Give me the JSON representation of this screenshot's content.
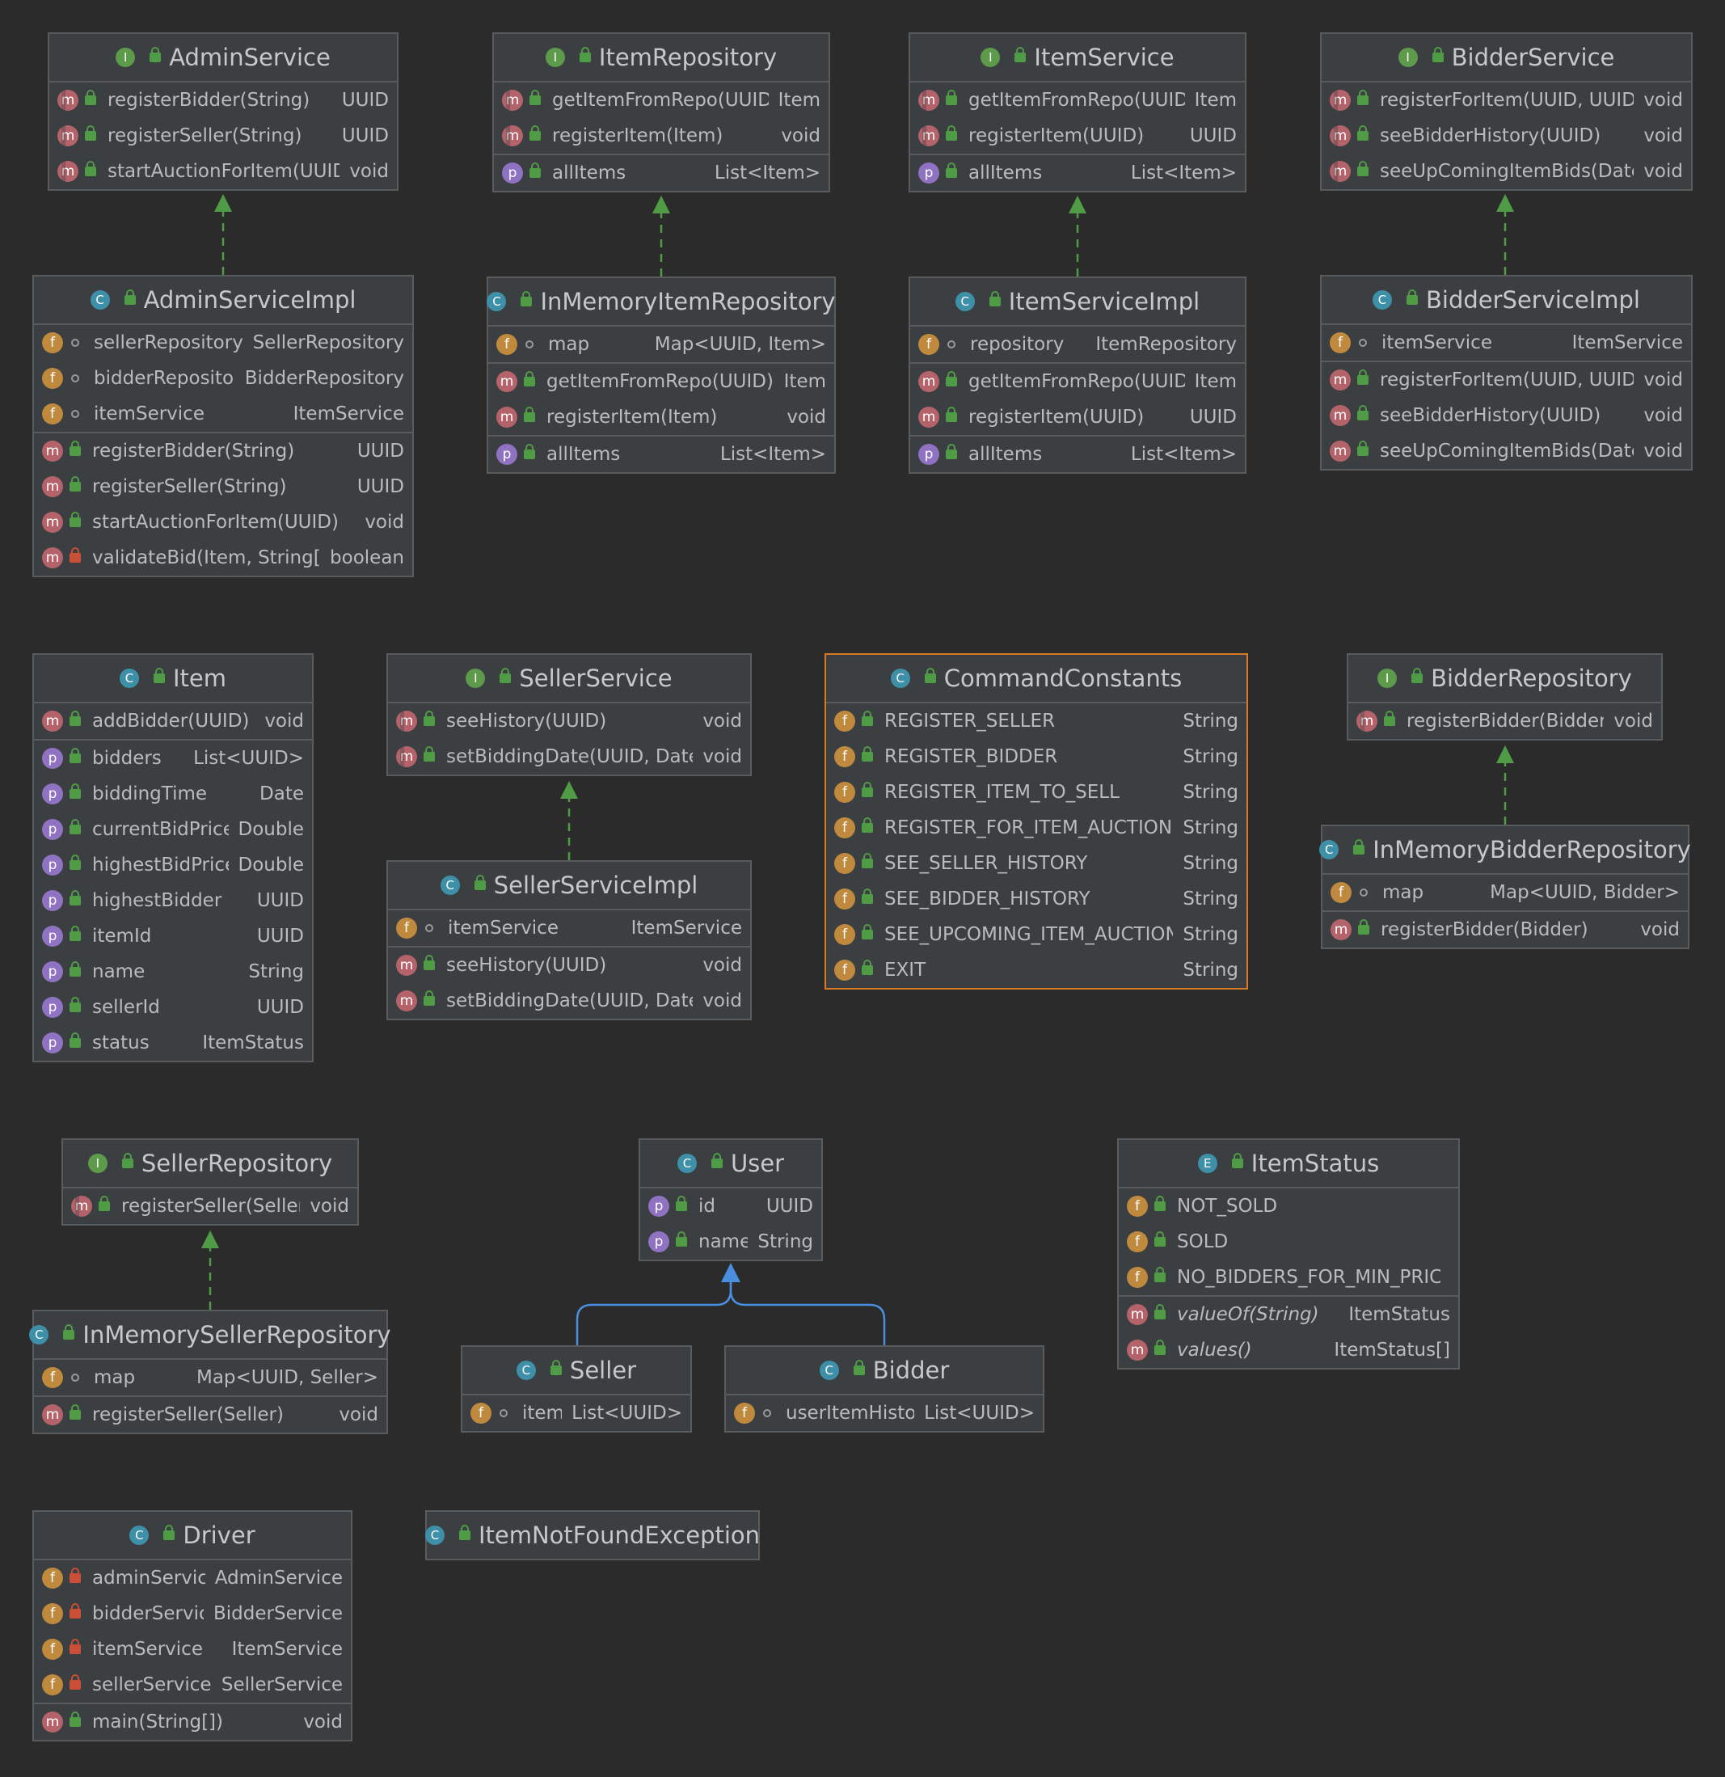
{
  "colors": {
    "background": "#2b2b2b",
    "class_fill": "#3c3f41",
    "border": "#595b5d",
    "selected_border": "#d97a25",
    "realization_edge": "#4f9b46",
    "inheritance_edge": "#4a8ee0"
  },
  "classes": {
    "admin_service": {
      "kind": "I",
      "title": "AdminService",
      "members": [
        [
          {
            "icon": "m",
            "abs": true,
            "vis": "pub",
            "name": "registerBidder(String)",
            "type": "UUID"
          },
          {
            "icon": "m",
            "abs": true,
            "vis": "pub",
            "name": "registerSeller(String)",
            "type": "UUID"
          },
          {
            "icon": "m",
            "abs": true,
            "vis": "pub",
            "name": "startAuctionForItem(UUID)",
            "type": "void"
          }
        ]
      ]
    },
    "item_repository": {
      "kind": "I",
      "title": "ItemRepository",
      "members": [
        [
          {
            "icon": "m",
            "abs": true,
            "vis": "pub",
            "name": "getItemFromRepo(UUID)",
            "type": "Item"
          },
          {
            "icon": "m",
            "abs": true,
            "vis": "pub",
            "name": "registerItem(Item)",
            "type": "void"
          }
        ],
        [
          {
            "icon": "p",
            "vis": "pub",
            "name": "allItems",
            "type": "List<Item>"
          }
        ]
      ]
    },
    "item_service": {
      "kind": "I",
      "title": "ItemService",
      "members": [
        [
          {
            "icon": "m",
            "abs": true,
            "vis": "pub",
            "name": "getItemFromRepo(UUID)",
            "type": "Item"
          },
          {
            "icon": "m",
            "abs": true,
            "vis": "pub",
            "name": "registerItem(UUID)",
            "type": "UUID"
          }
        ],
        [
          {
            "icon": "p",
            "vis": "pub",
            "name": "allItems",
            "type": "List<Item>"
          }
        ]
      ]
    },
    "bidder_service": {
      "kind": "I",
      "title": "BidderService",
      "members": [
        [
          {
            "icon": "m",
            "abs": true,
            "vis": "pub",
            "name": "registerForItem(UUID, UUID)",
            "type": "void"
          },
          {
            "icon": "m",
            "abs": true,
            "vis": "pub",
            "name": "seeBidderHistory(UUID)",
            "type": "void"
          },
          {
            "icon": "m",
            "abs": true,
            "vis": "pub",
            "name": "seeUpComingItemBids(Date)",
            "type": "void"
          }
        ]
      ]
    },
    "admin_service_impl": {
      "kind": "C",
      "title": "AdminServiceImpl",
      "members": [
        [
          {
            "icon": "f",
            "vis": "pkg",
            "name": "sellerRepository",
            "type": "SellerRepository"
          },
          {
            "icon": "f",
            "vis": "pkg",
            "name": "bidderRepository",
            "type": "BidderRepository"
          },
          {
            "icon": "f",
            "vis": "pkg",
            "name": "itemService",
            "type": "ItemService"
          }
        ],
        [
          {
            "icon": "m",
            "vis": "pub",
            "name": "registerBidder(String)",
            "type": "UUID"
          },
          {
            "icon": "m",
            "vis": "pub",
            "name": "registerSeller(String)",
            "type": "UUID"
          },
          {
            "icon": "m",
            "vis": "pub",
            "name": "startAuctionForItem(UUID)",
            "type": "void"
          },
          {
            "icon": "m",
            "vis": "priv",
            "name": "validateBid(Item, String[])",
            "type": "boolean"
          }
        ]
      ]
    },
    "in_memory_item_repository": {
      "kind": "C",
      "title": "InMemoryItemRepository",
      "members": [
        [
          {
            "icon": "f",
            "vis": "pkg",
            "name": "map",
            "type": "Map<UUID, Item>"
          }
        ],
        [
          {
            "icon": "m",
            "vis": "pub",
            "name": "getItemFromRepo(UUID)",
            "type": "Item"
          },
          {
            "icon": "m",
            "vis": "pub",
            "name": "registerItem(Item)",
            "type": "void"
          }
        ],
        [
          {
            "icon": "p",
            "vis": "pub",
            "name": "allItems",
            "type": "List<Item>"
          }
        ]
      ]
    },
    "item_service_impl": {
      "kind": "C",
      "title": "ItemServiceImpl",
      "members": [
        [
          {
            "icon": "f",
            "vis": "pkg",
            "name": "repository",
            "type": "ItemRepository"
          }
        ],
        [
          {
            "icon": "m",
            "vis": "pub",
            "name": "getItemFromRepo(UUID)",
            "type": "Item"
          },
          {
            "icon": "m",
            "vis": "pub",
            "name": "registerItem(UUID)",
            "type": "UUID"
          }
        ],
        [
          {
            "icon": "p",
            "vis": "pub",
            "name": "allItems",
            "type": "List<Item>"
          }
        ]
      ]
    },
    "bidder_service_impl": {
      "kind": "C",
      "title": "BidderServiceImpl",
      "members": [
        [
          {
            "icon": "f",
            "vis": "pkg",
            "name": "itemService",
            "type": "ItemService"
          }
        ],
        [
          {
            "icon": "m",
            "vis": "pub",
            "name": "registerForItem(UUID, UUID)",
            "type": "void"
          },
          {
            "icon": "m",
            "vis": "pub",
            "name": "seeBidderHistory(UUID)",
            "type": "void"
          },
          {
            "icon": "m",
            "vis": "pub",
            "name": "seeUpComingItemBids(Date)",
            "type": "void"
          }
        ]
      ]
    },
    "item": {
      "kind": "C",
      "title": "Item",
      "members": [
        [
          {
            "icon": "m",
            "vis": "pub",
            "name": "addBidder(UUID)",
            "type": "void"
          }
        ],
        [
          {
            "icon": "p",
            "vis": "pub",
            "name": "bidders",
            "type": "List<UUID>"
          },
          {
            "icon": "p",
            "vis": "pub",
            "name": "biddingTime",
            "type": "Date"
          },
          {
            "icon": "p",
            "vis": "pub",
            "name": "currentBidPrice",
            "type": "Double"
          },
          {
            "icon": "p",
            "vis": "pub",
            "name": "highestBidPrice",
            "type": "Double"
          },
          {
            "icon": "p",
            "vis": "pub",
            "name": "highestBidder",
            "type": "UUID"
          },
          {
            "icon": "p",
            "vis": "pub",
            "name": "itemId",
            "type": "UUID"
          },
          {
            "icon": "p",
            "vis": "pub",
            "name": "name",
            "type": "String"
          },
          {
            "icon": "p",
            "vis": "pub",
            "name": "sellerId",
            "type": "UUID"
          },
          {
            "icon": "p",
            "vis": "pub",
            "name": "status",
            "type": "ItemStatus"
          }
        ]
      ]
    },
    "seller_service": {
      "kind": "I",
      "title": "SellerService",
      "members": [
        [
          {
            "icon": "m",
            "abs": true,
            "vis": "pub",
            "name": "seeHistory(UUID)",
            "type": "void"
          },
          {
            "icon": "m",
            "abs": true,
            "vis": "pub",
            "name": "setBiddingDate(UUID, Date)",
            "type": "void"
          }
        ]
      ]
    },
    "seller_service_impl": {
      "kind": "C",
      "title": "SellerServiceImpl",
      "members": [
        [
          {
            "icon": "f",
            "vis": "pkg",
            "name": "itemService",
            "type": "ItemService"
          }
        ],
        [
          {
            "icon": "m",
            "vis": "pub",
            "name": "seeHistory(UUID)",
            "type": "void"
          },
          {
            "icon": "m",
            "vis": "pub",
            "name": "setBiddingDate(UUID, Date)",
            "type": "void"
          }
        ]
      ]
    },
    "command_constants": {
      "kind": "C",
      "title": "CommandConstants",
      "selected": true,
      "members": [
        [
          {
            "icon": "f",
            "vis": "pub",
            "name": "REGISTER_SELLER",
            "type": "String"
          },
          {
            "icon": "f",
            "vis": "pub",
            "name": "REGISTER_BIDDER",
            "type": "String"
          },
          {
            "icon": "f",
            "vis": "pub",
            "name": "REGISTER_ITEM_TO_SELL",
            "type": "String"
          },
          {
            "icon": "f",
            "vis": "pub",
            "name": "REGISTER_FOR_ITEM_AUCTION",
            "type": "String"
          },
          {
            "icon": "f",
            "vis": "pub",
            "name": "SEE_SELLER_HISTORY",
            "type": "String"
          },
          {
            "icon": "f",
            "vis": "pub",
            "name": "SEE_BIDDER_HISTORY",
            "type": "String"
          },
          {
            "icon": "f",
            "vis": "pub",
            "name": "SEE_UPCOMING_ITEM_AUCTIONS",
            "type": "String"
          },
          {
            "icon": "f",
            "vis": "pub",
            "name": "EXIT",
            "type": "String"
          }
        ]
      ]
    },
    "bidder_repository": {
      "kind": "I",
      "title": "BidderRepository",
      "members": [
        [
          {
            "icon": "m",
            "abs": true,
            "vis": "pub",
            "name": "registerBidder(Bidder)",
            "type": "void"
          }
        ]
      ]
    },
    "in_memory_bidder_repository": {
      "kind": "C",
      "title": "InMemoryBidderRepository",
      "members": [
        [
          {
            "icon": "f",
            "vis": "pkg",
            "name": "map",
            "type": "Map<UUID, Bidder>"
          }
        ],
        [
          {
            "icon": "m",
            "vis": "pub",
            "name": "registerBidder(Bidder)",
            "type": "void"
          }
        ]
      ]
    },
    "seller_repository": {
      "kind": "I",
      "title": "SellerRepository",
      "members": [
        [
          {
            "icon": "m",
            "abs": true,
            "vis": "pub",
            "name": "registerSeller(Seller)",
            "type": "void"
          }
        ]
      ]
    },
    "in_memory_seller_repository": {
      "kind": "C",
      "title": "InMemorySellerRepository",
      "members": [
        [
          {
            "icon": "f",
            "vis": "pkg",
            "name": "map",
            "type": "Map<UUID, Seller>"
          }
        ],
        [
          {
            "icon": "m",
            "vis": "pub",
            "name": "registerSeller(Seller)",
            "type": "void"
          }
        ]
      ]
    },
    "user": {
      "kind": "C",
      "title": "User",
      "members": [
        [
          {
            "icon": "p",
            "vis": "pub",
            "name": "id",
            "type": "UUID"
          },
          {
            "icon": "p",
            "vis": "pub",
            "name": "name",
            "type": "String"
          }
        ]
      ]
    },
    "item_status": {
      "kind": "E",
      "title": "ItemStatus",
      "members": [
        [
          {
            "icon": "f",
            "vis": "pub",
            "name": "NOT_SOLD",
            "type": ""
          },
          {
            "icon": "f",
            "vis": "pub",
            "name": "SOLD",
            "type": ""
          },
          {
            "icon": "f",
            "vis": "pub",
            "name": "NO_BIDDERS_FOR_MIN_PRICE",
            "type": ""
          }
        ],
        [
          {
            "icon": "m",
            "vis": "pub",
            "italic": true,
            "name": "valueOf(String)",
            "type": "ItemStatus"
          },
          {
            "icon": "m",
            "vis": "pub",
            "italic": true,
            "name": "values()",
            "type": "ItemStatus[]"
          }
        ]
      ]
    },
    "seller": {
      "kind": "C",
      "title": "Seller",
      "members": [
        [
          {
            "icon": "f",
            "vis": "pkg",
            "name": "items",
            "type": "List<UUID>"
          }
        ]
      ]
    },
    "bidder": {
      "kind": "C",
      "title": "Bidder",
      "members": [
        [
          {
            "icon": "f",
            "vis": "pkg",
            "name": "userItemHistory",
            "type": "List<UUID>"
          }
        ]
      ]
    },
    "driver": {
      "kind": "C",
      "title": "Driver",
      "members": [
        [
          {
            "icon": "f",
            "vis": "priv",
            "name": "adminService",
            "type": "AdminService"
          },
          {
            "icon": "f",
            "vis": "priv",
            "name": "bidderService",
            "type": "BidderService"
          },
          {
            "icon": "f",
            "vis": "priv",
            "name": "itemService",
            "type": "ItemService"
          },
          {
            "icon": "f",
            "vis": "priv",
            "name": "sellerService",
            "type": "SellerService"
          }
        ],
        [
          {
            "icon": "m",
            "vis": "pub",
            "name": "main(String[])",
            "type": "void"
          }
        ]
      ]
    },
    "item_not_found_exception": {
      "kind": "C",
      "title": "ItemNotFoundException",
      "members": []
    }
  },
  "edges": [
    {
      "from": "admin_service_impl",
      "to": "admin_service",
      "type": "realization"
    },
    {
      "from": "in_memory_item_repository",
      "to": "item_repository",
      "type": "realization"
    },
    {
      "from": "item_service_impl",
      "to": "item_service",
      "type": "realization"
    },
    {
      "from": "bidder_service_impl",
      "to": "bidder_service",
      "type": "realization"
    },
    {
      "from": "seller_service_impl",
      "to": "seller_service",
      "type": "realization"
    },
    {
      "from": "in_memory_bidder_repository",
      "to": "bidder_repository",
      "type": "realization"
    },
    {
      "from": "in_memory_seller_repository",
      "to": "seller_repository",
      "type": "realization"
    },
    {
      "from": "seller",
      "to": "user",
      "type": "inheritance"
    },
    {
      "from": "bidder",
      "to": "user",
      "type": "inheritance"
    }
  ]
}
